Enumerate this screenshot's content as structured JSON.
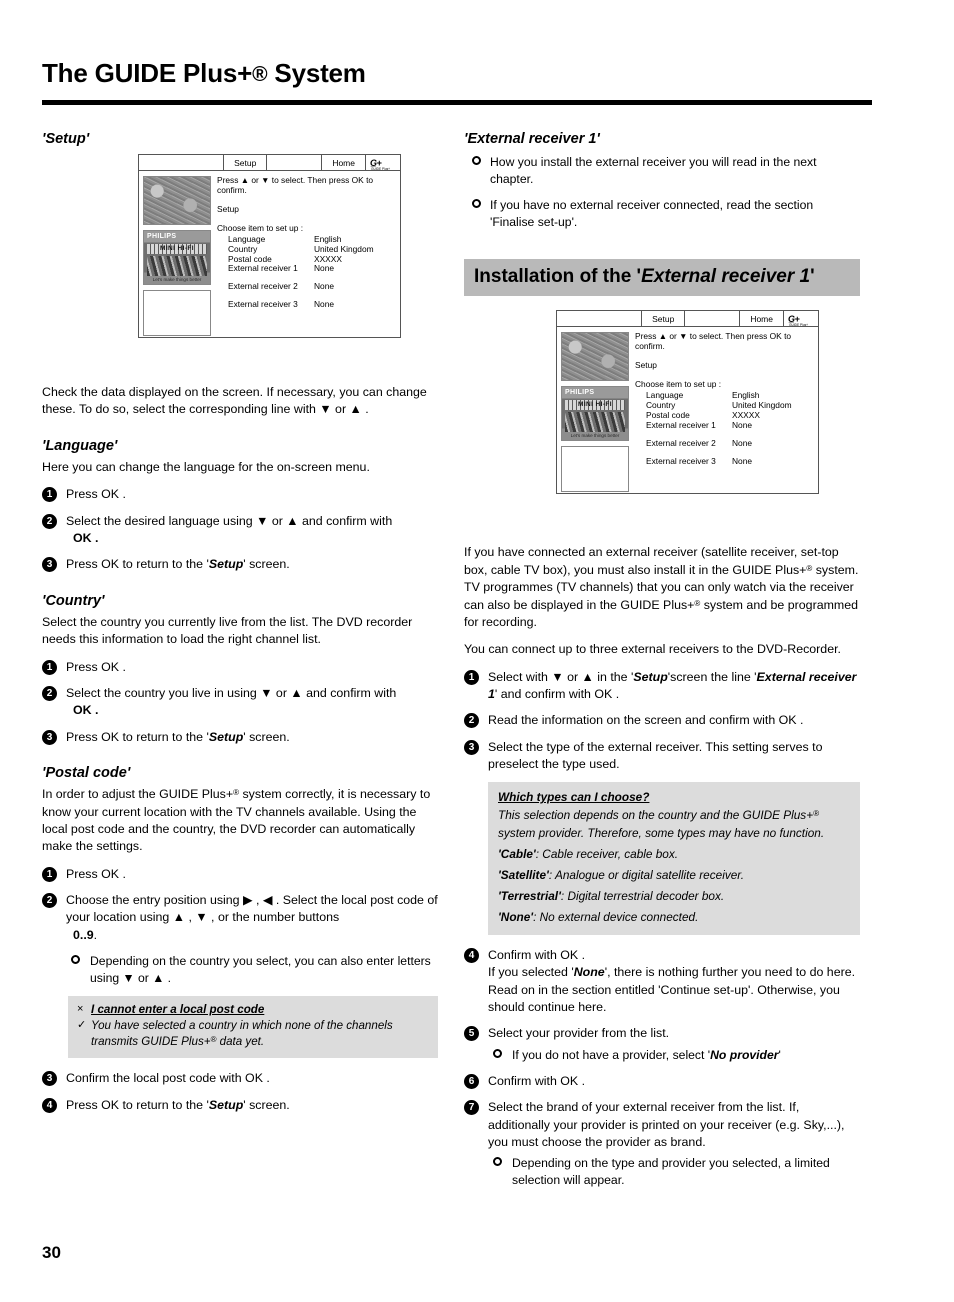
{
  "header": {
    "title_pre": "The ",
    "title_bold": "GUIDE",
    "title_rest": " Plus+",
    "title_reg": "®",
    "title_end": " System"
  },
  "page_number": "30",
  "tv_screen": {
    "tab_setup": "Setup",
    "tab_home": "Home",
    "logo_main": "G̲+",
    "logo_sub": "GUIDE Plus+",
    "hint": "Press ▲ or ▼ to select. Then press OK to confirm.",
    "title": "Setup",
    "choose": "Choose item to set up :",
    "ad_brand": "PHILIPS",
    "ad_line": "MINI HI-FI",
    "ad_footer": "Let's make things better",
    "rows": [
      {
        "label": "Language",
        "value": "English"
      },
      {
        "label": "Country",
        "value": "United Kingdom"
      },
      {
        "label": "Postal code",
        "value": "XXXXX"
      },
      {
        "label": "External receiver 1",
        "value": "None"
      },
      {
        "label": "External receiver 2",
        "value": "None"
      },
      {
        "label": "External receiver 3",
        "value": "None"
      }
    ]
  },
  "left": {
    "setup": {
      "heading": "'Setup'",
      "intro": "Check the data displayed on the screen. If necessary, you can change these. To do so, select the corresponding line with ▼ or ▲ ."
    },
    "language": {
      "heading": "'Language'",
      "intro": "Here you can change the language for the on-screen menu.",
      "step1": "Press  OK .",
      "step2_a": "Select the desired language using ▼ or ▲ and confirm with",
      "step2_b": "OK .",
      "step3_a": "Press  OK to return to the '",
      "step3_b": "Setup",
      "step3_c": "' screen."
    },
    "country": {
      "heading": "'Country'",
      "intro": "Select the country you currently live from the list. The DVD recorder needs this information to load the right channel list.",
      "step1": "Press  OK .",
      "step2_a": "Select the country you live in using ▼ or ▲ and confirm with",
      "step2_b": "OK .",
      "step3_a": "Press  OK to return to the '",
      "step3_b": "Setup",
      "step3_c": "' screen."
    },
    "postal": {
      "heading": "'Postal code'",
      "intro_a": "In order to adjust the GUIDE Plus+",
      "intro_b": " system correctly, it is necessary to know your current location with the TV channels available. Using the local post code and the country, the DVD recorder can automatically make the settings.",
      "step1": "Press  OK .",
      "step2_a": "Choose the entry position using ▶ , ◀ . Select the local post code of your location using ▲ , ▼ , or the number buttons",
      "step2_b": "0..9",
      "step2_c": ".",
      "bullet": "Depending on the country you select, you can also enter letters using ▼ or ▲ .",
      "note_mark_x": "×",
      "note_mark_check": "✓",
      "note_title": "I cannot enter a local post code",
      "note_body_a": "You have selected a country in which none of the channels transmits GUIDE Plus+",
      "note_body_b": " data yet.",
      "step3": "Confirm the local post code with  OK .",
      "step4_a": "Press  OK to return to the '",
      "step4_b": "Setup",
      "step4_c": "' screen."
    }
  },
  "right": {
    "extrec": {
      "heading": "'External receiver 1'",
      "bullet1": "How you install the external receiver you will read in the next chapter.",
      "bullet2": "If you have no external receiver connected, read the section 'Finalise set-up'."
    },
    "banner": {
      "pre": "Installation of the '",
      "italic": "External receiver 1",
      "post": "'"
    },
    "intro_a": "If you have connected an external receiver (satellite receiver, set-top box, cable TV box), you must also install it in the GUIDE Plus+",
    "intro_b": " system. TV programmes (TV channels) that you can only watch via the receiver can also be displayed in the GUIDE Plus+",
    "intro_c": " system and be programmed for recording.",
    "intro_d": "You can connect up to three external receivers to the DVD-Recorder.",
    "step1_a": "Select with ▼ or ▲ in the '",
    "step1_b": "Setup",
    "step1_c": "'screen the line '",
    "step1_d": "External receiver 1",
    "step1_e": "' and confirm with  OK .",
    "step2": "Read the information on the screen and confirm with  OK .",
    "step3": "Select the type of the external receiver. This setting serves to preselect the type used.",
    "types_note": {
      "title": "Which types can I choose?",
      "body_a": "This selection depends on the country and the GUIDE Plus+",
      "body_b": " system provider. Therefore, some types may have no function.",
      "items": [
        {
          "name": "'Cable'",
          "desc": ": Cable receiver, cable box."
        },
        {
          "name": "'Satellite'",
          "desc": ": Analogue or digital satellite receiver."
        },
        {
          "name": "'Terrestrial'",
          "desc": ": Digital terrestrial decoder box."
        },
        {
          "name": "'None'",
          "desc": ": No external device connected."
        }
      ]
    },
    "step4_a": "Confirm with  OK .",
    "step4_b": "If you selected '",
    "step4_c": "None",
    "step4_d": "', there is nothing further you need to do here. Read on in the section entitled 'Continue set-up'. Otherwise, you should continue here.",
    "step5": "Select your provider from the list.",
    "step5_bullet_a": "If you do not have a provider, select '",
    "step5_bullet_b": "No provider",
    "step5_bullet_c": "'",
    "step6": "Confirm with  OK .",
    "step7": "Select the brand of your external receiver from the list. If, additionally your provider is printed on your receiver (e.g. Sky,...), you must choose the provider as brand.",
    "step7_bullet": "Depending on the type and provider you selected, a limited selection will appear."
  },
  "colors": {
    "banner_gray": "#b9b9b9",
    "note_gray": "#dcdcdc"
  }
}
